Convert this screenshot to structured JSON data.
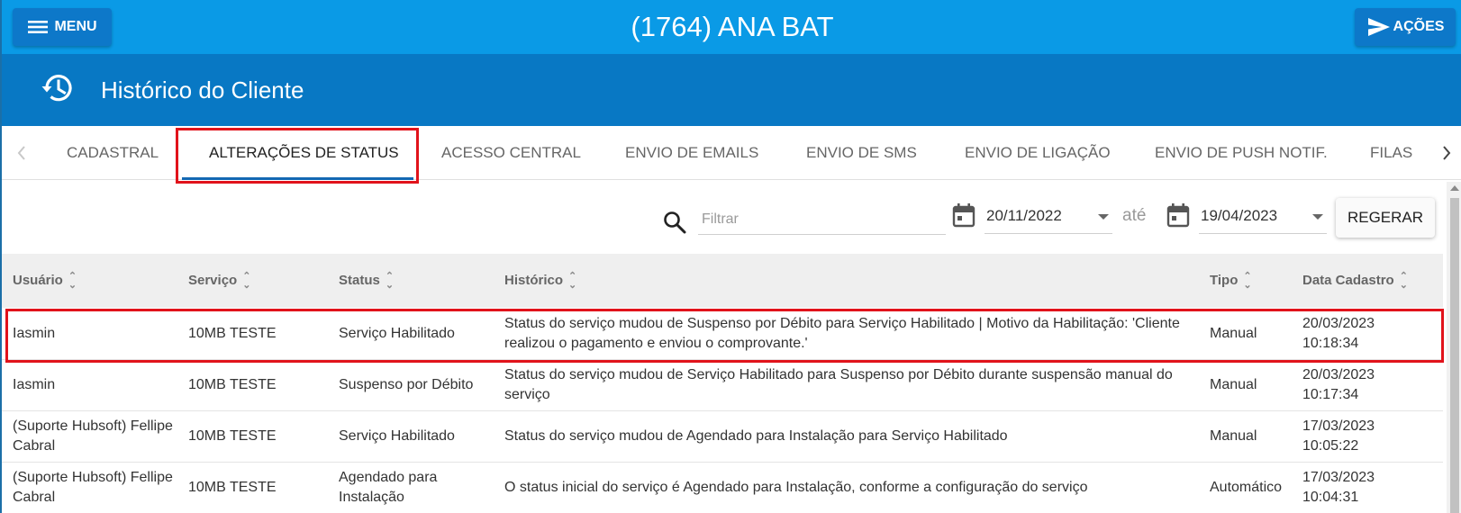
{
  "header": {
    "menu_label": "MENU",
    "title": "(1764) ANA BAT",
    "actions_label": "AÇÕES"
  },
  "section": {
    "title": "Histórico do Cliente"
  },
  "tabs": [
    {
      "label": "CADASTRAL",
      "active": false
    },
    {
      "label": "ALTERAÇÕES DE STATUS",
      "active": true
    },
    {
      "label": "ACESSO CENTRAL",
      "active": false
    },
    {
      "label": "ENVIO DE EMAILS",
      "active": false
    },
    {
      "label": "ENVIO DE SMS",
      "active": false
    },
    {
      "label": "ENVIO DE LIGAÇÃO",
      "active": false
    },
    {
      "label": "ENVIO DE PUSH NOTIF.",
      "active": false
    },
    {
      "label": "FILAS",
      "active": false
    }
  ],
  "filters": {
    "search_placeholder": "Filtrar",
    "date_from": "20/11/2022",
    "range_separator": "até",
    "date_to": "19/04/2023",
    "regenerate_label": "REGERAR"
  },
  "table": {
    "columns": [
      "Usuário",
      "Serviço",
      "Status",
      "Histórico",
      "Tipo",
      "Data Cadastro"
    ],
    "rows": [
      {
        "usuario": "Iasmin",
        "servico": "10MB TESTE",
        "status": "Serviço Habilitado",
        "historico": "Status do serviço mudou de Suspenso por Débito para Serviço Habilitado | Motivo da Habilitação: 'Cliente realizou o pagamento e enviou o comprovante.'",
        "tipo": "Manual",
        "data": "20/03/2023 10:18:34",
        "highlighted": true
      },
      {
        "usuario": "Iasmin",
        "servico": "10MB TESTE",
        "status": "Suspenso por Débito",
        "historico": "Status do serviço mudou de Serviço Habilitado para Suspenso por Débito durante suspensão manual do serviço",
        "tipo": "Manual",
        "data": "20/03/2023 10:17:34",
        "highlighted": false
      },
      {
        "usuario": "(Suporte Hubsoft) Fellipe Cabral",
        "servico": "10MB TESTE",
        "status": "Serviço Habilitado",
        "historico": "Status do serviço mudou de Agendado para Instalação para Serviço Habilitado",
        "tipo": "Manual",
        "data": "17/03/2023 10:05:22",
        "highlighted": false
      },
      {
        "usuario": "(Suporte Hubsoft) Fellipe Cabral",
        "servico": "10MB TESTE",
        "status": "Agendado para Instalação",
        "historico": "O status inicial do serviço é Agendado para Instalação, conforme a configuração do serviço",
        "tipo": "Automático",
        "data": "17/03/2023 10:04:31",
        "highlighted": false
      }
    ]
  },
  "icons": {
    "menu": "hamburger-icon",
    "actions": "send-icon",
    "section": "history-icon",
    "search": "search-icon",
    "calendar": "calendar-icon"
  },
  "colors": {
    "topbar": "#0a9ae6",
    "section_header": "#0878c4",
    "button": "#0d78c9",
    "tab_indicator": "#1468b3",
    "highlight_border": "#e1131b"
  }
}
